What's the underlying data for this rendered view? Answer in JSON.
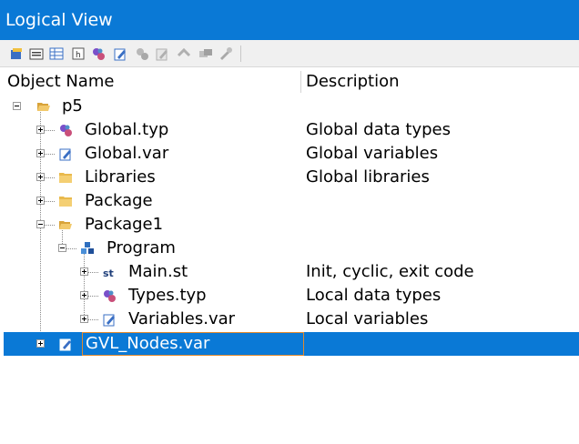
{
  "window": {
    "title": "Logical View"
  },
  "toolbar": {
    "buttons": [
      {
        "icon": "new-object-icon"
      },
      {
        "icon": "properties-icon"
      },
      {
        "icon": "table-icon"
      },
      {
        "icon": "help-icon"
      },
      {
        "icon": "data-type-icon"
      },
      {
        "icon": "variable-icon"
      },
      {
        "icon": "disabled-type-icon"
      },
      {
        "icon": "disabled-edit-icon"
      },
      {
        "icon": "disabled-link-icon"
      },
      {
        "icon": "disabled-transfer-icon"
      },
      {
        "icon": "disabled-tool-icon"
      }
    ]
  },
  "columns": {
    "name": "Object Name",
    "description": "Description"
  },
  "tree": [
    {
      "name": "p5",
      "description": "",
      "icon": "open-folder-icon"
    },
    {
      "name": "Global.typ",
      "description": "Global data types",
      "icon": "data-type-icon"
    },
    {
      "name": "Global.var",
      "description": "Global variables",
      "icon": "variable-icon"
    },
    {
      "name": "Libraries",
      "description": "Global libraries",
      "icon": "folder-icon"
    },
    {
      "name": "Package",
      "description": "",
      "icon": "folder-icon"
    },
    {
      "name": "Package1",
      "description": "",
      "icon": "open-folder-icon"
    },
    {
      "name": "Program",
      "description": "",
      "icon": "program-icon"
    },
    {
      "name": "Main.st",
      "description": "Init, cyclic, exit code",
      "icon": "structured-text-icon"
    },
    {
      "name": "Types.typ",
      "description": "Local data types",
      "icon": "data-type-icon"
    },
    {
      "name": "Variables.var",
      "description": "Local variables",
      "icon": "variable-icon"
    },
    {
      "name": "GVL_Nodes.var",
      "description": "",
      "icon": "variable-icon",
      "selected": true
    }
  ],
  "colors": {
    "accent": "#0a79d6",
    "edit_border": "#e08a2e"
  }
}
